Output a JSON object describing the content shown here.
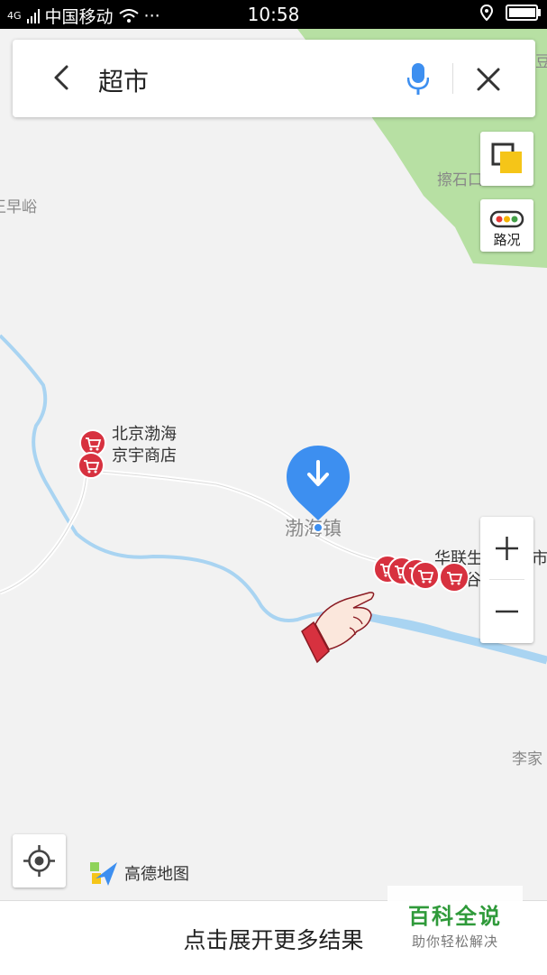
{
  "status_bar": {
    "network": "4G",
    "carrier": "中国移动",
    "dots": "···",
    "time": "10:58",
    "battery_level": 0.9
  },
  "search": {
    "query": "超市"
  },
  "map_controls": {
    "traffic_label": "路况",
    "zoom_in": "+",
    "zoom_out": "−"
  },
  "map_labels": {
    "place_left": "王早峪",
    "place_top_right": "擦石口",
    "place_top_right_edge": "豆",
    "town": "渤海镇",
    "place_bottom_right": "李家",
    "poi_left_line1": "北京渤海",
    "poi_left_line2": "京宇商店",
    "poi_right_a": "华联生",
    "poi_right_b": "市",
    "poi_right_c": "谷"
  },
  "brand": {
    "name": "高德地图"
  },
  "bottom": {
    "more_results": "点击展开更多结果"
  },
  "watermark": {
    "title": "百科全说",
    "subtitle": "助你轻松解决"
  },
  "colors": {
    "map_bg": "#f2f2f2",
    "forest": "#b7e0a3",
    "river": "#a9d4f2",
    "road": "#ffffff",
    "poi_red": "#d7313f",
    "marker_blue": "#3d8ff0",
    "watermark_green": "#2f9a3a"
  }
}
